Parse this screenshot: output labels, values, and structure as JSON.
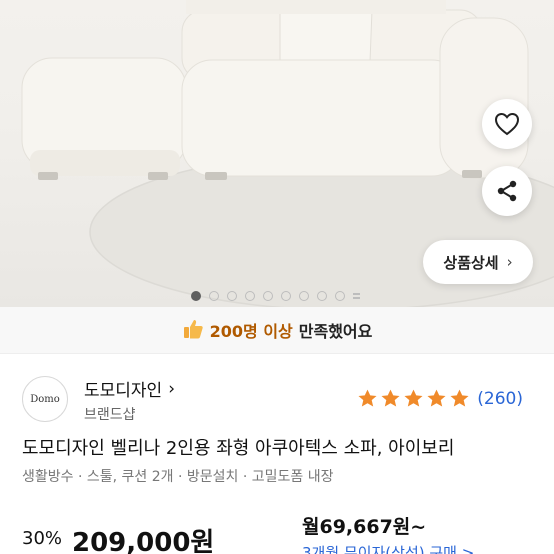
{
  "hero": {
    "detail_button_label": "상품상세",
    "pager": {
      "total": 9,
      "active_index": 0
    }
  },
  "satisfaction": {
    "count_text": "200명 이상",
    "rest_text": "만족했어요"
  },
  "brand": {
    "logo_text": "Domo",
    "name": "도모디자인",
    "subtitle": "브랜드샵",
    "rating_stars": 5,
    "review_count": "(260)"
  },
  "product": {
    "title": "도모디자인 벨리나 2인용 좌형 아쿠아텍스 소파, 아이보리",
    "subtitle": "생활방수 · 스툴, 쿠션 2개 · 방문설치 · 고밀도폼 내장"
  },
  "price": {
    "discount": "30%",
    "amount": "209,000원",
    "monthly": "월69,667원~",
    "monthly_sub": "3개월 무이자(삼성) 구매 >"
  },
  "colors": {
    "accent_blue": "#2a66d6",
    "star_orange": "#f08a2a",
    "satisfy_orange": "#b05a00"
  }
}
